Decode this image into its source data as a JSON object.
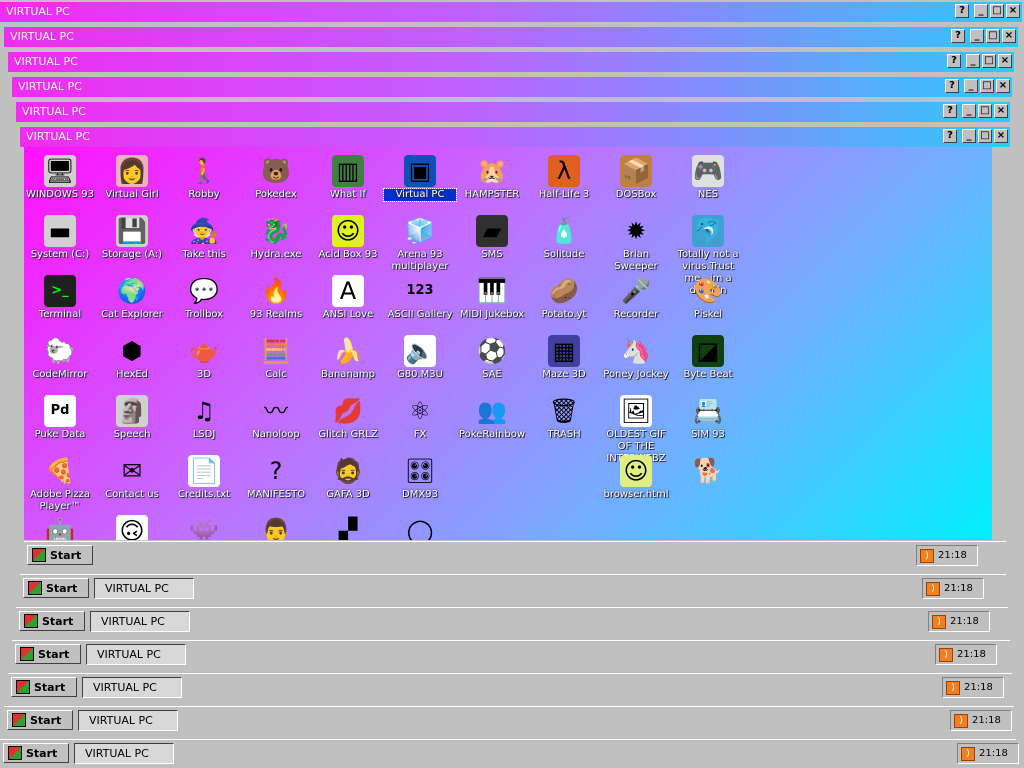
{
  "window_title": "VIRTUAL PC",
  "title_buttons": [
    "?",
    "_",
    "□",
    "×"
  ],
  "taskbar": {
    "start_label": "Start",
    "task_label": "VIRTUAL PC",
    "clock": "21:18"
  },
  "desktop_icons": [
    {
      "label": "WINDOWS 93",
      "icon": "computer-icon",
      "glyph": "🖥",
      "bg": "#d0d0d0"
    },
    {
      "label": "Virtual Girl",
      "icon": "virtual-girl-icon",
      "glyph": "👩",
      "bg": "#f0b0c0"
    },
    {
      "label": "Robby",
      "icon": "robby-icon",
      "glyph": "🚶",
      "bg": "transparent"
    },
    {
      "label": "Pokedex",
      "icon": "pokedex-icon",
      "glyph": "🐻",
      "bg": "transparent"
    },
    {
      "label": "What If",
      "icon": "what-if-icon",
      "glyph": "▥",
      "bg": "#408040"
    },
    {
      "label": "Virtual PC",
      "icon": "virtual-pc-icon",
      "glyph": "▣",
      "bg": "#3070d0"
    },
    {
      "label": "HAMPSTER",
      "icon": "hampster-icon",
      "glyph": "🐹",
      "bg": "transparent"
    },
    {
      "label": "Half-Life 3",
      "icon": "half-life-icon",
      "glyph": "λ",
      "bg": "#e06020"
    },
    {
      "label": "DOSBox",
      "icon": "dosbox-icon",
      "glyph": "📦",
      "bg": "#c08040"
    },
    {
      "label": "NES",
      "icon": "nes-icon",
      "glyph": "🎮",
      "bg": "#e0e0e0"
    },
    {
      "label": "System (C:)",
      "icon": "hard-drive-icon",
      "glyph": "▬",
      "bg": "#d0d0d0"
    },
    {
      "label": "Storage (A:)",
      "icon": "floppy-drive-icon",
      "glyph": "💾",
      "bg": "#d0d0d0"
    },
    {
      "label": "Take this",
      "icon": "wizard-icon",
      "glyph": "🧙",
      "bg": "transparent"
    },
    {
      "label": "Hydra.exe",
      "icon": "hydra-icon",
      "glyph": "🐉",
      "bg": "transparent"
    },
    {
      "label": "Acid Box 93",
      "icon": "smiley-icon",
      "glyph": "☺",
      "bg": "#e0f020"
    },
    {
      "label": "Arena 93 multiplayer",
      "icon": "cube-icon",
      "glyph": "🧊",
      "bg": "transparent"
    },
    {
      "label": "SMS",
      "icon": "sms-console-icon",
      "glyph": "▰",
      "bg": "#303030"
    },
    {
      "label": "Solitude",
      "icon": "solitude-icon",
      "glyph": "🧴",
      "bg": "transparent"
    },
    {
      "label": "Brian Sweeper",
      "icon": "mine-icon",
      "glyph": "✹",
      "bg": "transparent"
    },
    {
      "label": "Totally not a virus.Trust me...im a dolphin",
      "icon": "dolphin-icon",
      "glyph": "🐬",
      "bg": "#40a0d0"
    },
    {
      "label": "Terminal",
      "icon": "terminal-icon",
      "glyph": ">_",
      "bg": "#202020"
    },
    {
      "label": "Cat Explorer",
      "icon": "globe-icon",
      "glyph": "🌍",
      "bg": "transparent"
    },
    {
      "label": "Trollbox",
      "icon": "trollbox-icon",
      "glyph": "💬",
      "bg": "transparent"
    },
    {
      "label": "93 Realms",
      "icon": "realms-icon",
      "glyph": "🔥",
      "bg": "transparent"
    },
    {
      "label": "ANSI Love",
      "icon": "ansi-icon",
      "glyph": "A",
      "bg": "#ffffff"
    },
    {
      "label": "ASCII Gallery",
      "icon": "ascii-icon",
      "glyph": "123",
      "bg": "transparent"
    },
    {
      "label": "MIDI Jukebox",
      "icon": "piano-icon",
      "glyph": "🎹",
      "bg": "transparent"
    },
    {
      "label": "Potato.yt",
      "icon": "potato-icon",
      "glyph": "🥔",
      "bg": "transparent"
    },
    {
      "label": "Recorder",
      "icon": "microphone-icon",
      "glyph": "🎤",
      "bg": "transparent"
    },
    {
      "label": "Piskel",
      "icon": "palette-icon",
      "glyph": "🎨",
      "bg": "transparent"
    },
    {
      "label": "CodeMirror",
      "icon": "codemirror-icon",
      "glyph": "🐑",
      "bg": "transparent"
    },
    {
      "label": "HexEd",
      "icon": "hexed-icon",
      "glyph": "⬢",
      "bg": "transparent"
    },
    {
      "label": "3D",
      "icon": "teapot-icon",
      "glyph": "🫖",
      "bg": "transparent"
    },
    {
      "label": "Calc",
      "icon": "calculator-icon",
      "glyph": "🧮",
      "bg": "transparent"
    },
    {
      "label": "Bananamp",
      "icon": "banana-icon",
      "glyph": "🍌",
      "bg": "transparent"
    },
    {
      "label": "G80.M3U",
      "icon": "audio-file-icon",
      "glyph": "🔈",
      "bg": "#ffffff"
    },
    {
      "label": "SAE",
      "icon": "amiga-ball-icon",
      "glyph": "⚽",
      "bg": "transparent"
    },
    {
      "label": "Maze 3D",
      "icon": "maze-icon",
      "glyph": "▦",
      "bg": "#4040a0"
    },
    {
      "label": "Poney Jockey",
      "icon": "pony-icon",
      "glyph": "🦄",
      "bg": "transparent"
    },
    {
      "label": "Byte Beat",
      "icon": "bytebeat-icon",
      "glyph": "◪",
      "bg": "#104010"
    },
    {
      "label": "Puke Data",
      "icon": "puke-data-icon",
      "glyph": "Pd",
      "bg": "#ffffff"
    },
    {
      "label": "Speech",
      "icon": "speech-icon",
      "glyph": "🗿",
      "bg": "#d0d0d0"
    },
    {
      "label": "LSDJ",
      "icon": "lsdj-icon",
      "glyph": "♫",
      "bg": "transparent"
    },
    {
      "label": "Nanoloop",
      "icon": "nanoloop-icon",
      "glyph": "〰",
      "bg": "transparent"
    },
    {
      "label": "Glitch GRLZ",
      "icon": "lips-icon",
      "glyph": "💋",
      "bg": "transparent"
    },
    {
      "label": "FX",
      "icon": "atom-icon",
      "glyph": "⚛",
      "bg": "transparent"
    },
    {
      "label": "PokeRainbow",
      "icon": "pokerainbow-icon",
      "glyph": "👥",
      "bg": "transparent"
    },
    {
      "label": "TRASH",
      "icon": "trash-icon",
      "glyph": "🗑",
      "bg": "transparent"
    },
    {
      "label": "OLDEST GIF OF THE INTERWEBZ",
      "icon": "gif-file-icon",
      "glyph": "🖼",
      "bg": "#ffffff"
    },
    {
      "label": "SIM 93",
      "icon": "sim-icon",
      "glyph": "📇",
      "bg": "transparent"
    },
    {
      "label": "Adobe Pizza Player™",
      "icon": "pizza-icon",
      "glyph": "🍕",
      "bg": "transparent"
    },
    {
      "label": "Contact us",
      "icon": "contact-icon",
      "glyph": "✉",
      "bg": "transparent"
    },
    {
      "label": "Credits.txt",
      "icon": "text-file-icon",
      "glyph": "📄",
      "bg": "#ffffff"
    },
    {
      "label": "MANIFESTO",
      "icon": "question-icon",
      "glyph": "?",
      "bg": "transparent"
    },
    {
      "label": "GAFA 3D",
      "icon": "gafa-icon",
      "glyph": "🧔",
      "bg": "transparent"
    },
    {
      "label": "DMX93",
      "icon": "dmx-icon",
      "glyph": "🎛",
      "bg": "transparent"
    },
    {
      "label": "browser.html",
      "icon": "html-file-icon",
      "glyph": "☺",
      "bg": "#e0f080"
    },
    {
      "label": "",
      "icon": "gif-file-icon",
      "glyph": "🖼",
      "bg": "#ffffff"
    },
    {
      "label": "",
      "icon": "yoda-icon",
      "glyph": "👽",
      "bg": "transparent"
    },
    {
      "label": "",
      "icon": "corgi-icon",
      "glyph": "🐕",
      "bg": "transparent"
    },
    {
      "label": "",
      "icon": "robot-icon",
      "glyph": "🤖",
      "bg": "transparent"
    },
    {
      "label": "",
      "icon": "face-icon",
      "glyph": "🙃",
      "bg": "#ffffff"
    },
    {
      "label": "",
      "icon": "space-invader-icon",
      "glyph": "👾",
      "bg": "transparent"
    },
    {
      "label": "",
      "icon": "portrait-icon",
      "glyph": "👨",
      "bg": "transparent"
    },
    {
      "label": "",
      "icon": "tetris-icon",
      "glyph": "▞",
      "bg": "transparent"
    },
    {
      "label": "",
      "icon": "donut-icon",
      "glyph": "◯",
      "bg": "transparent"
    }
  ]
}
